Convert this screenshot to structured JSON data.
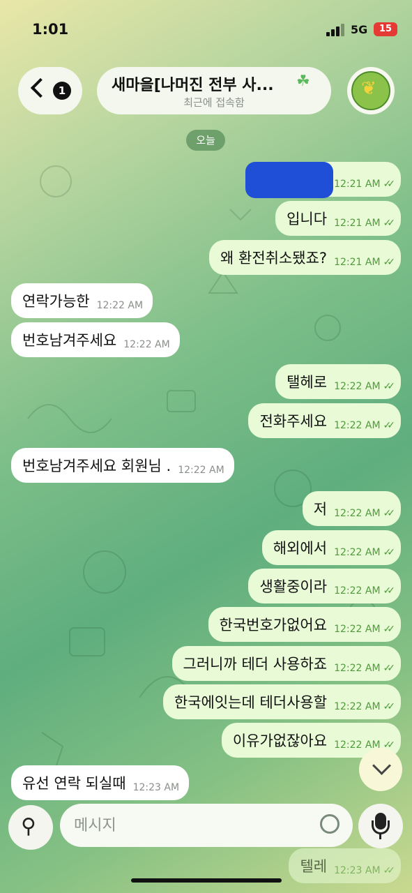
{
  "status_bar": {
    "time": "1:01",
    "network": "5G",
    "battery": "15"
  },
  "header": {
    "unread_count": "1",
    "title": "새마을[나머진 전부 사...",
    "subtitle": "최근에 접속함"
  },
  "date_chip": "오늘",
  "messages": [
    {
      "dir": "out",
      "text": "",
      "time": "12:21 AM",
      "redacted": true
    },
    {
      "dir": "out",
      "text": "입니다",
      "time": "12:21 AM"
    },
    {
      "dir": "out",
      "text": "왜 환전취소됐죠?",
      "time": "12:21 AM"
    },
    {
      "dir": "in",
      "text": "연락가능한",
      "time": "12:22 AM"
    },
    {
      "dir": "in",
      "text": "번호남겨주세요",
      "time": "12:22 AM"
    },
    {
      "dir": "out",
      "text": "탤헤로",
      "time": "12:22 AM"
    },
    {
      "dir": "out",
      "text": "전화주세요",
      "time": "12:22 AM"
    },
    {
      "dir": "in",
      "text": "번호남겨주세요 회원님 .",
      "time": "12:22 AM"
    },
    {
      "dir": "out",
      "text": "저",
      "time": "12:22 AM"
    },
    {
      "dir": "out",
      "text": "해외에서",
      "time": "12:22 AM"
    },
    {
      "dir": "out",
      "text": "생활중이라",
      "time": "12:22 AM"
    },
    {
      "dir": "out",
      "text": "한국번호가없어요",
      "time": "12:22 AM"
    },
    {
      "dir": "out",
      "text": "그러니까 테더 사용하죠",
      "time": "12:22 AM"
    },
    {
      "dir": "out",
      "text": "한국에잇는데 테더사용할",
      "time": "12:22 AM"
    },
    {
      "dir": "out",
      "text": "이유가없잖아요",
      "time": "12:22 AM"
    },
    {
      "dir": "in",
      "text": "유선 연락 되실때",
      "time": "12:23 AM"
    },
    {
      "dir": "out",
      "text": "텔레",
      "time": "12:23 AM"
    }
  ],
  "composer": {
    "placeholder": "메시지"
  },
  "icons": {
    "back": "chevron-left-icon",
    "attach": "paperclip-icon",
    "sticker": "sticker-icon",
    "mic": "microphone-icon",
    "scroll": "chevron-down-icon"
  },
  "colors": {
    "outgoing_bubble": "#e9fbd6",
    "incoming_bubble": "#ffffff",
    "accent_green": "#4f9a3b"
  }
}
